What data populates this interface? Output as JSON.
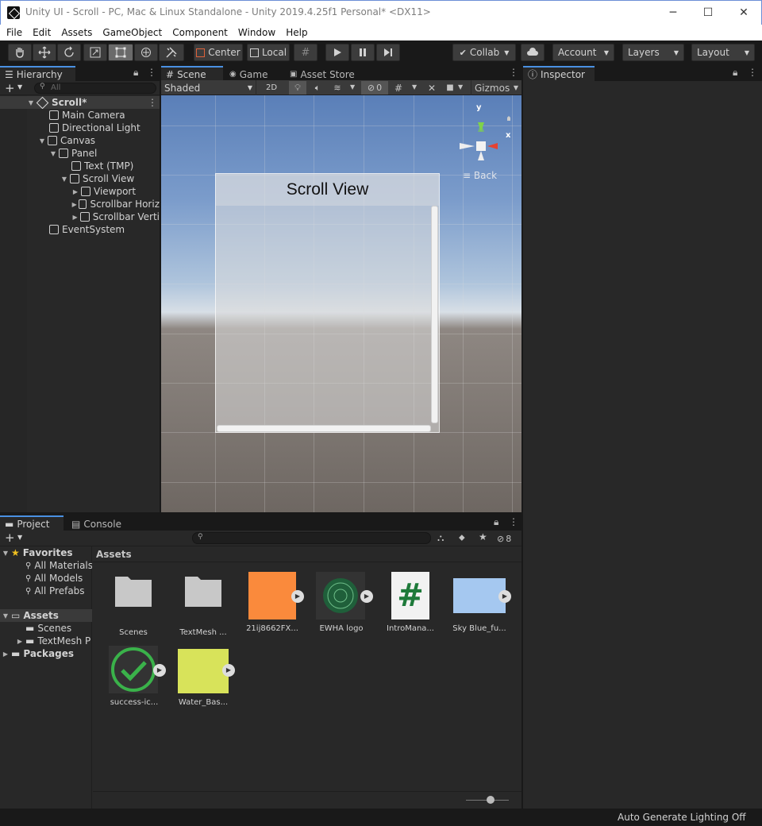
{
  "window": {
    "title": "Unity UI - Scroll - PC, Mac & Linux Standalone - Unity 2019.4.25f1 Personal* <DX11>",
    "minimize": "─",
    "maximize": "☐",
    "close": "✕"
  },
  "menu": [
    "File",
    "Edit",
    "Assets",
    "GameObject",
    "Component",
    "Window",
    "Help"
  ],
  "toolbar": {
    "pivot_center": "Center",
    "pivot_local": "Local",
    "collab": "Collab",
    "account": "Account",
    "layers": "Layers",
    "layout": "Layout"
  },
  "hierarchy": {
    "tab": "Hierarchy",
    "search_placeholder": "All",
    "scene": "Scroll*",
    "items": [
      {
        "label": "Main Camera"
      },
      {
        "label": "Directional Light"
      },
      {
        "label": "Canvas"
      },
      {
        "label": "Panel"
      },
      {
        "label": "Text (TMP)"
      },
      {
        "label": "Scroll View"
      },
      {
        "label": "Viewport"
      },
      {
        "label": "Scrollbar Horiz"
      },
      {
        "label": "Scrollbar Verti"
      },
      {
        "label": "EventSystem"
      }
    ]
  },
  "scene": {
    "tabs": [
      "Scene",
      "Game",
      "Asset Store"
    ],
    "shading": "Shaded",
    "mode_2d": "2D",
    "hidden_count": "0",
    "gizmos": "Gizmos",
    "gizmo_y": "y",
    "gizmo_x": "x",
    "back_label": "Back",
    "scroll_view_text": "Scroll View"
  },
  "inspector": {
    "tab": "Inspector"
  },
  "project": {
    "tabs": [
      "Project",
      "Console"
    ],
    "hidden_count": "8",
    "favorites": "Favorites",
    "favorite_items": [
      "All Materials",
      "All Models",
      "All Prefabs"
    ],
    "assets_root": "Assets",
    "asset_folders": [
      "Scenes",
      "TextMesh P"
    ],
    "packages": "Packages",
    "breadcrumb": "Assets",
    "assets": [
      {
        "label": "Scenes",
        "kind": "folder"
      },
      {
        "label": "TextMesh ...",
        "kind": "folder"
      },
      {
        "label": "21ij8662FX...",
        "kind": "image",
        "color": "#fa8a3c"
      },
      {
        "label": "EWHA logo",
        "kind": "logo"
      },
      {
        "label": "IntroMana...",
        "kind": "script",
        "glyph": "#"
      },
      {
        "label": "Sky Blue_fu...",
        "kind": "image",
        "color": "#a5c8f0"
      },
      {
        "label": "success-ic...",
        "kind": "check"
      },
      {
        "label": "Water_Bas...",
        "kind": "image",
        "color": "#d8e35a"
      }
    ]
  },
  "statusbar": {
    "text": "Auto Generate Lighting Off"
  }
}
